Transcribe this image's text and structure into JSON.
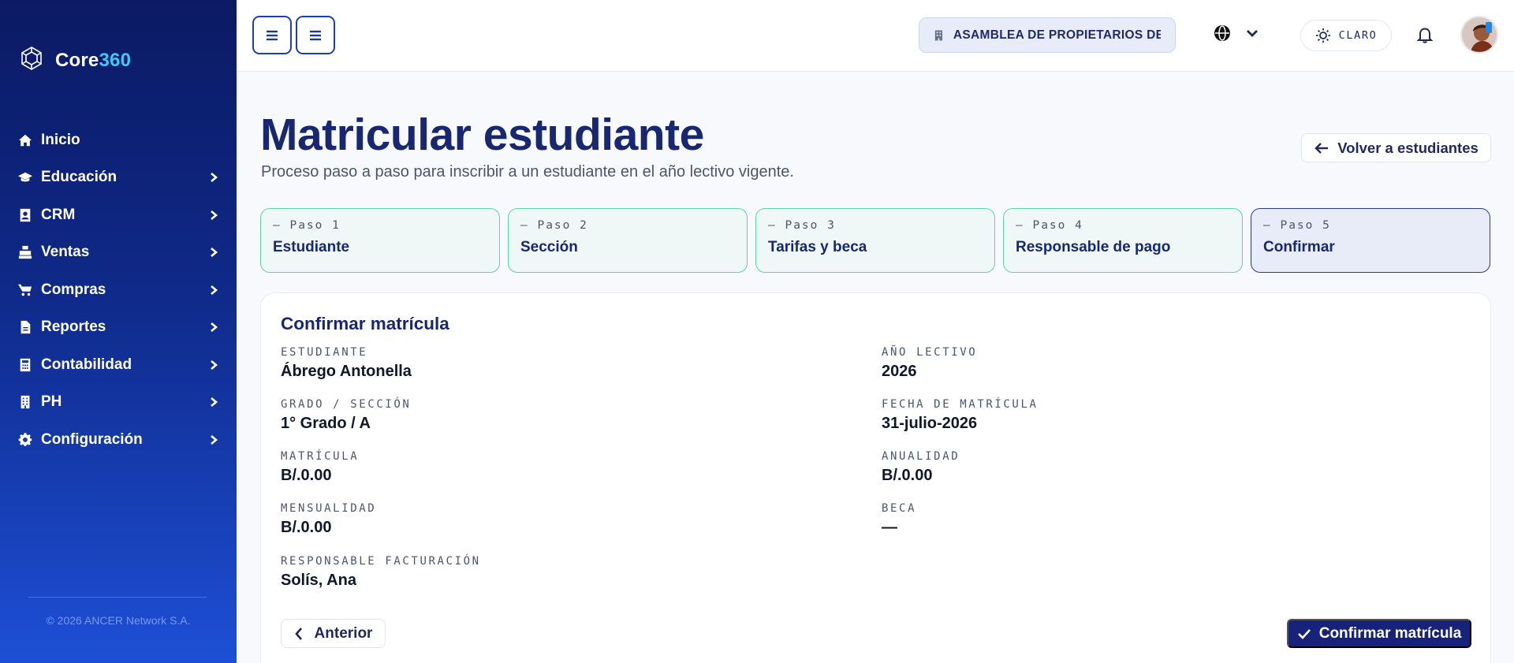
{
  "app": {
    "brand_part1": "Core",
    "brand_part2": "360"
  },
  "sidebar": {
    "items": [
      {
        "label": "Inicio",
        "icon": "home-icon",
        "has_submenu": false
      },
      {
        "label": "Educación",
        "icon": "graduation-cap-icon",
        "has_submenu": true
      },
      {
        "label": "CRM",
        "icon": "contact-card-icon",
        "has_submenu": true
      },
      {
        "label": "Ventas",
        "icon": "cash-register-icon",
        "has_submenu": true
      },
      {
        "label": "Compras",
        "icon": "shopping-cart-icon",
        "has_submenu": true
      },
      {
        "label": "Reportes",
        "icon": "report-file-icon",
        "has_submenu": true
      },
      {
        "label": "Contabilidad",
        "icon": "calculator-icon",
        "has_submenu": true
      },
      {
        "label": "PH",
        "icon": "building-icon",
        "has_submenu": true
      },
      {
        "label": "Configuración",
        "icon": "gear-icon",
        "has_submenu": true
      }
    ],
    "copyright": "© 2026 ANCER Network S.A."
  },
  "topbar": {
    "organization": "ASAMBLEA DE PROPIETARIOS DE ...",
    "theme_label": "CLARO"
  },
  "page": {
    "title": "Matricular estudiante",
    "subtitle": "Proceso paso a paso para inscribir a un estudiante en el año lectivo vigente.",
    "back_label": "Volver a estudiantes"
  },
  "steps": [
    {
      "kicker": "— Paso 1",
      "label": "Estudiante",
      "state": "done"
    },
    {
      "kicker": "— Paso 2",
      "label": "Sección",
      "state": "done"
    },
    {
      "kicker": "— Paso 3",
      "label": "Tarifas y beca",
      "state": "done"
    },
    {
      "kicker": "— Paso 4",
      "label": "Responsable de pago",
      "state": "done"
    },
    {
      "kicker": "— Paso 5",
      "label": "Confirmar",
      "state": "active"
    }
  ],
  "summary": {
    "title": "Confirmar matrícula",
    "fields": {
      "estudiante": {
        "label": "ESTUDIANTE",
        "value": "Ábrego Antonella"
      },
      "anio": {
        "label": "AÑO LECTIVO",
        "value": "2026"
      },
      "grado": {
        "label": "GRADO / SECCIÓN",
        "value": "1° Grado / A"
      },
      "fecha": {
        "label": "FECHA DE MATRÍCULA",
        "value": "31-julio-2026"
      },
      "matricula": {
        "label": "MATRÍCULA",
        "value": "B/.0.00"
      },
      "anualidad": {
        "label": "ANUALIDAD",
        "value": "B/.0.00"
      },
      "mensualidad": {
        "label": "MENSUALIDAD",
        "value": "B/.0.00"
      },
      "beca": {
        "label": "BECA",
        "value": "—"
      },
      "responsable": {
        "label": "RESPONSABLE FACTURACIÓN",
        "value": "Solís, Ana"
      }
    },
    "prev_label": "Anterior",
    "confirm_label": "Confirmar matrícula"
  },
  "colors": {
    "sidebar_top": "#0b1a63",
    "sidebar_bottom": "#1d4fd6",
    "brand_accent": "#3ec8f2",
    "primary": "#17237a",
    "step_done_border": "#5fd3a3",
    "step_active_border": "#2b3a8f"
  }
}
